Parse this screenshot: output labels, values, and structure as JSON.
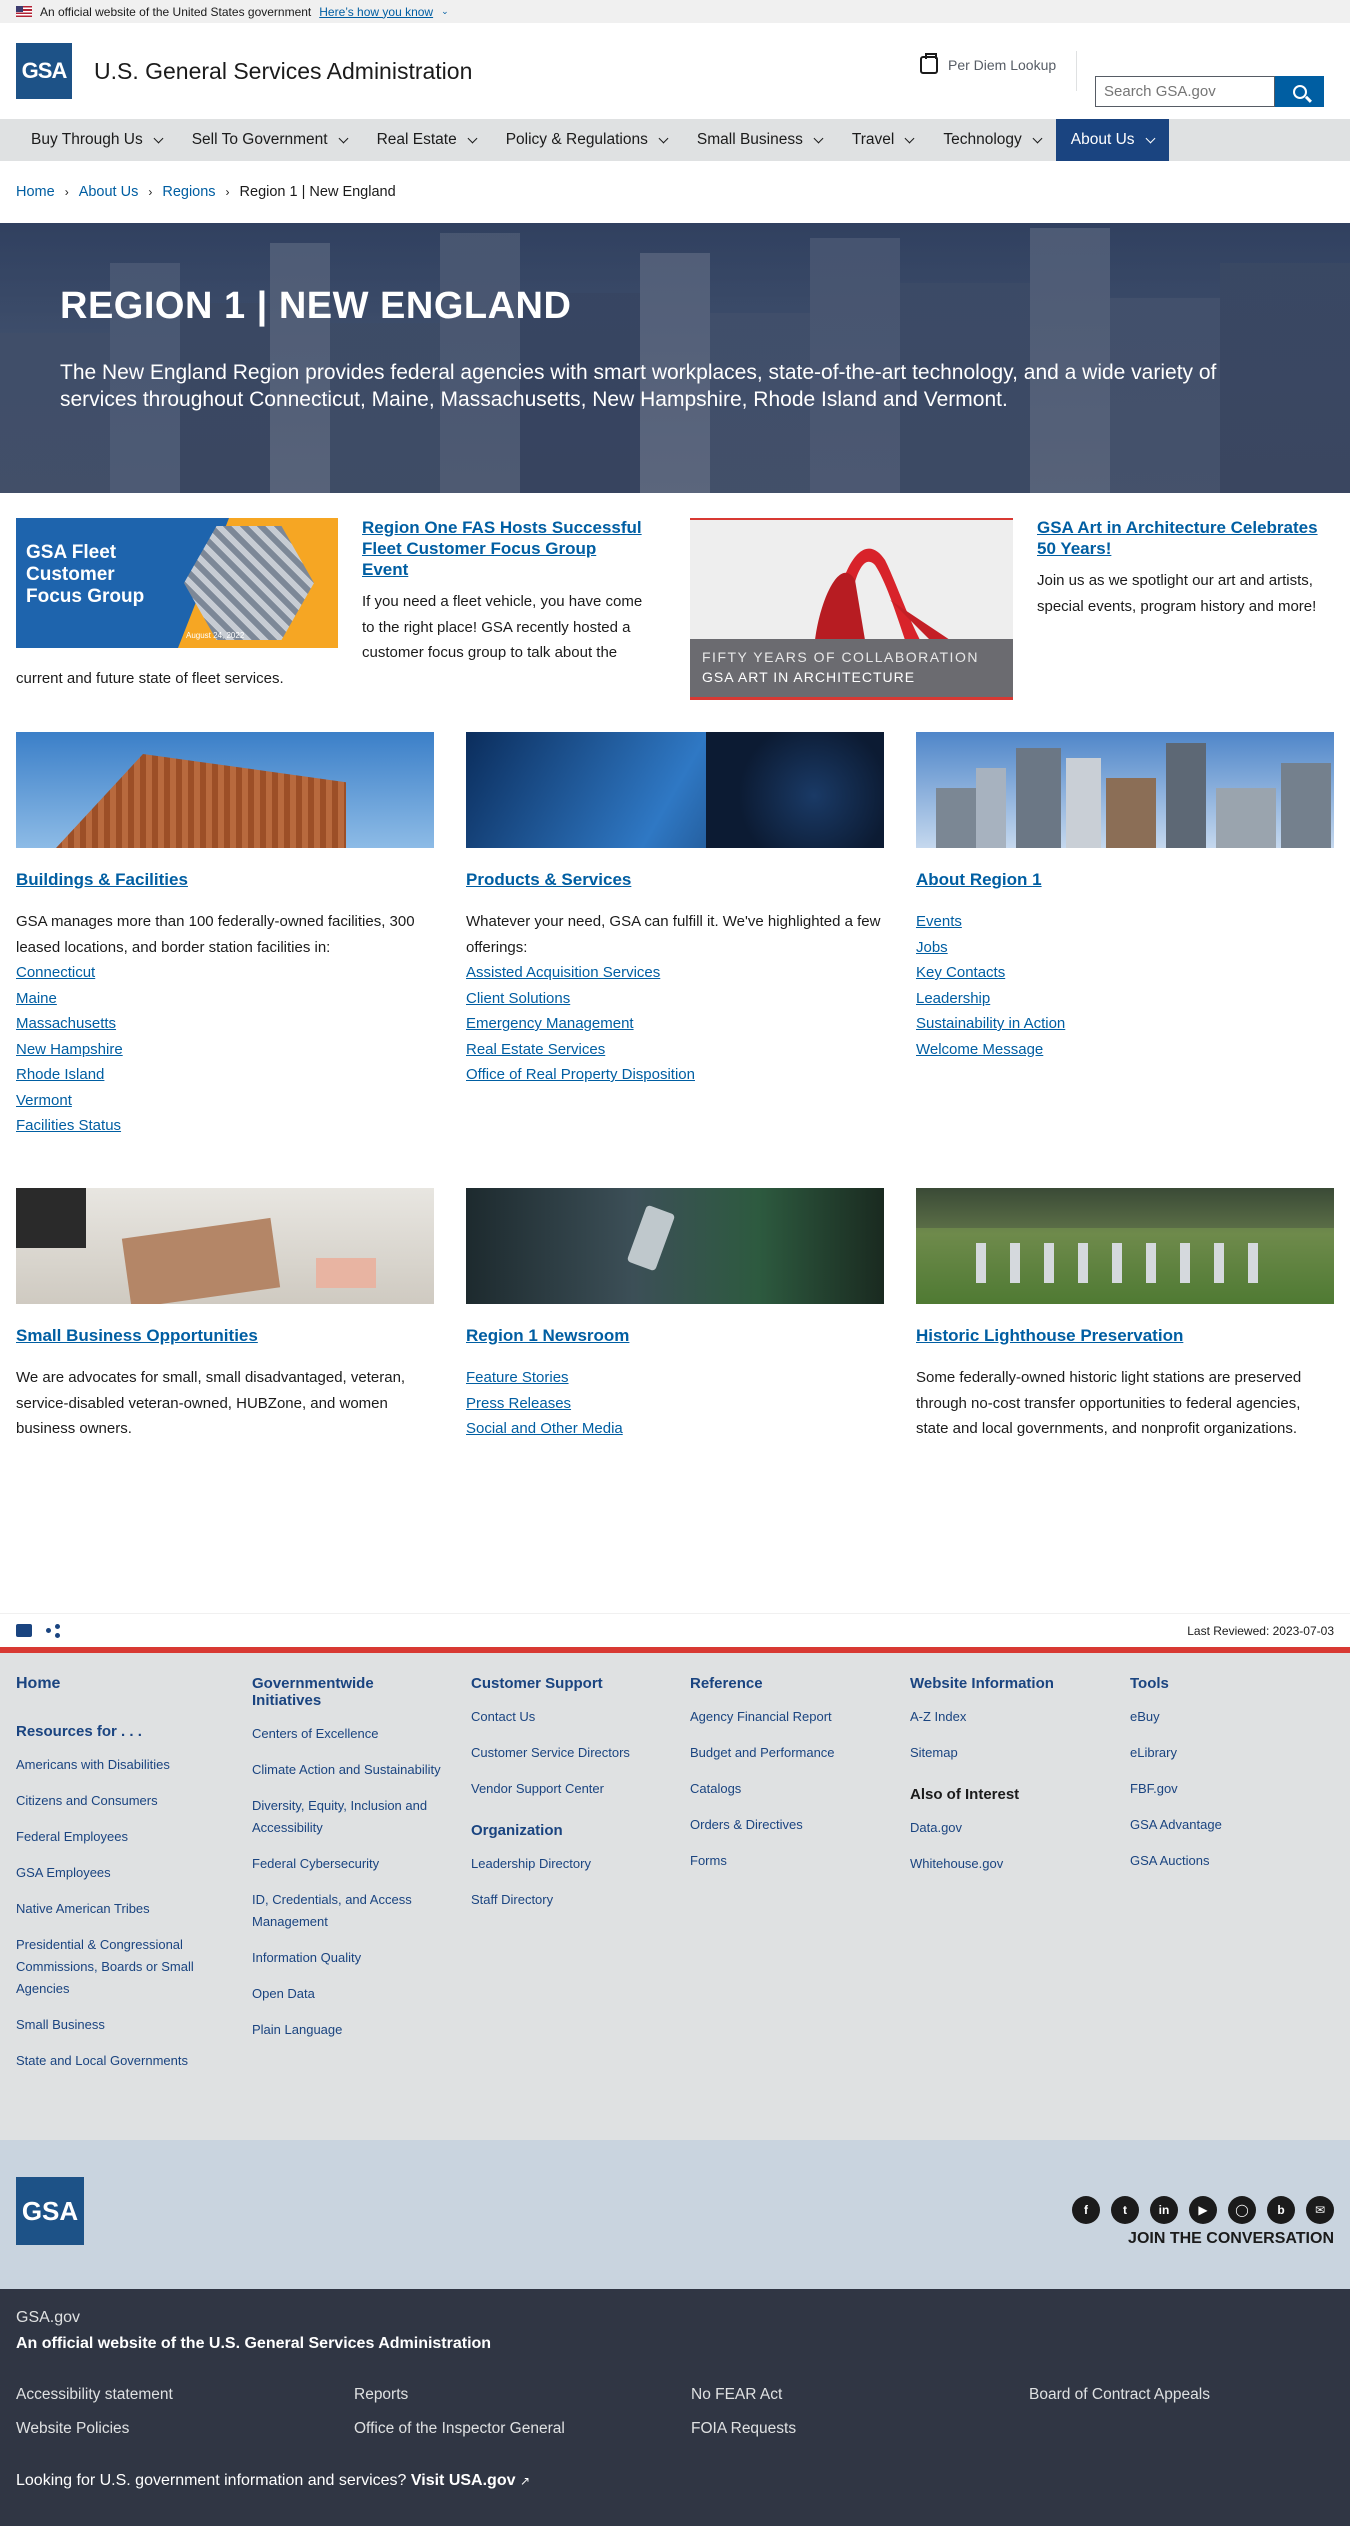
{
  "gov_banner": {
    "text": "An official website of the United States government",
    "link": "Here’s how you know"
  },
  "header": {
    "logo": "GSA",
    "site_name": "U.S. General Services Administration",
    "per_diem": "Per Diem Lookup",
    "search_placeholder": "Search GSA.gov"
  },
  "nav": {
    "items": [
      "Buy Through Us",
      "Sell To Government",
      "Real Estate",
      "Policy & Regulations",
      "Small Business",
      "Travel",
      "Technology",
      "About Us"
    ]
  },
  "breadcrumb": [
    "Home",
    "About Us",
    "Regions",
    "Region 1 | New England"
  ],
  "hero": {
    "title": "REGION 1 | NEW ENGLAND",
    "text": "The New England Region provides federal agencies with smart workplaces, state-of-the-art technology, and a wide variety of services throughout Connecticut, Maine, Massachusetts, New Hampshire, Rhode Island and Vermont."
  },
  "feature1": {
    "img_text": "GSA Fleet Customer Focus Group",
    "img_date": "August 24, 2022",
    "title": "Region One FAS Hosts Successful Fleet Customer Focus Group Event",
    "text": "If you need a fleet vehicle, you have come to the right place! GSA recently hosted a customer focus group to talk about the current and future state of fleet services."
  },
  "feature2": {
    "img_line1": "FIFTY YEARS OF COLLABORATION",
    "img_line2": "GSA ART IN ARCHITECTURE",
    "title": "GSA Art in Architecture Celebrates 50 Years!",
    "text": "Join us as we spotlight our art and artists, special events, program history and more!"
  },
  "cards": {
    "buildings": {
      "title": "Buildings & Facilities",
      "text": "GSA manages more than 100 federally-owned facilities, 300 leased locations, and border station facilities in:",
      "links": [
        "Connecticut",
        "Maine",
        "Massachusetts",
        "New Hampshire",
        "Rhode Island",
        "Vermont",
        "Facilities Status"
      ]
    },
    "products": {
      "title": "Products & Services",
      "text": "Whatever your need, GSA can fulfill it. We've highlighted a few offerings:",
      "links": [
        "Assisted Acquisition Services",
        "Client Solutions",
        "Emergency Management",
        "Real Estate Services",
        "Office of Real Property Disposition"
      ]
    },
    "about": {
      "title": "About Region 1",
      "links": [
        "Events",
        "Jobs",
        "Key Contacts",
        "Leadership",
        "Sustainability in Action",
        "Welcome Message"
      ]
    },
    "smallbiz": {
      "title": "Small Business Opportunities",
      "text": "We are advocates for small, small disadvantaged, veteran, service-disabled veteran-owned, HUBZone, and women business owners."
    },
    "newsroom": {
      "title": "Region 1 Newsroom",
      "links": [
        "Feature Stories",
        "Press Releases",
        "Social and Other Media"
      ]
    },
    "lighthouse": {
      "title": "Historic Lighthouse Preservation",
      "text": "Some federally-owned historic light stations are preserved through no-cost transfer opportunities to federal agencies, state and local governments, and nonprofit organizations."
    }
  },
  "last_reviewed": "Last Reviewed: 2023-07-03",
  "footer": {
    "col1": {
      "home": "Home",
      "heading": "Resources for . . .",
      "links": [
        "Americans with Disabilities",
        "Citizens and Consumers",
        "Federal Employees",
        "GSA Employees",
        "Native American Tribes",
        "Presidential & Congressional Commissions, Boards or Small Agencies",
        "Small Business",
        "State and Local Governments"
      ]
    },
    "col2": {
      "heading": "Governmentwide Initiatives",
      "links": [
        "Centers of Excellence",
        "Climate Action and Sustainability",
        "Diversity, Equity, Inclusion and Accessibility",
        "Federal Cybersecurity",
        "ID, Credentials, and Access Management",
        "Information Quality",
        "Open Data",
        "Plain Language"
      ]
    },
    "col3": {
      "heading": "Customer Support",
      "links": [
        "Contact Us",
        "Customer Service Directors",
        "Vendor Support Center"
      ],
      "heading2": "Organization",
      "links2": [
        "Leadership Directory",
        "Staff Directory"
      ]
    },
    "col4": {
      "heading": "Reference",
      "links": [
        "Agency Financial Report",
        "Budget and Performance",
        "Catalogs",
        "Orders & Directives",
        "Forms"
      ]
    },
    "col5": {
      "heading": "Website Information",
      "links": [
        "A-Z Index",
        "Sitemap"
      ],
      "heading2": "Also of Interest",
      "links2": [
        "Data.gov",
        "Whitehouse.gov"
      ]
    },
    "col6": {
      "heading": "Tools",
      "links": [
        "eBuy",
        "eLibrary",
        "FBF.gov",
        "GSA Advantage",
        "GSA Auctions"
      ]
    }
  },
  "social": {
    "icons": [
      "facebook-icon",
      "twitter-icon",
      "linkedin-icon",
      "youtube-icon",
      "instagram-icon",
      "blog-icon",
      "email-icon"
    ],
    "join": "JOIN THE CONVERSATION"
  },
  "identifier": {
    "domain": "GSA.gov",
    "official": "An official website of the U.S. General Services Administration",
    "links": [
      "Accessibility statement",
      "Reports",
      "No FEAR Act",
      "Board of Contract Appeals",
      "Website Policies",
      "Office of the Inspector General",
      "FOIA Requests"
    ],
    "usa_text": "Looking for U.S. government information and services?",
    "usa_link": "Visit USA.gov"
  }
}
